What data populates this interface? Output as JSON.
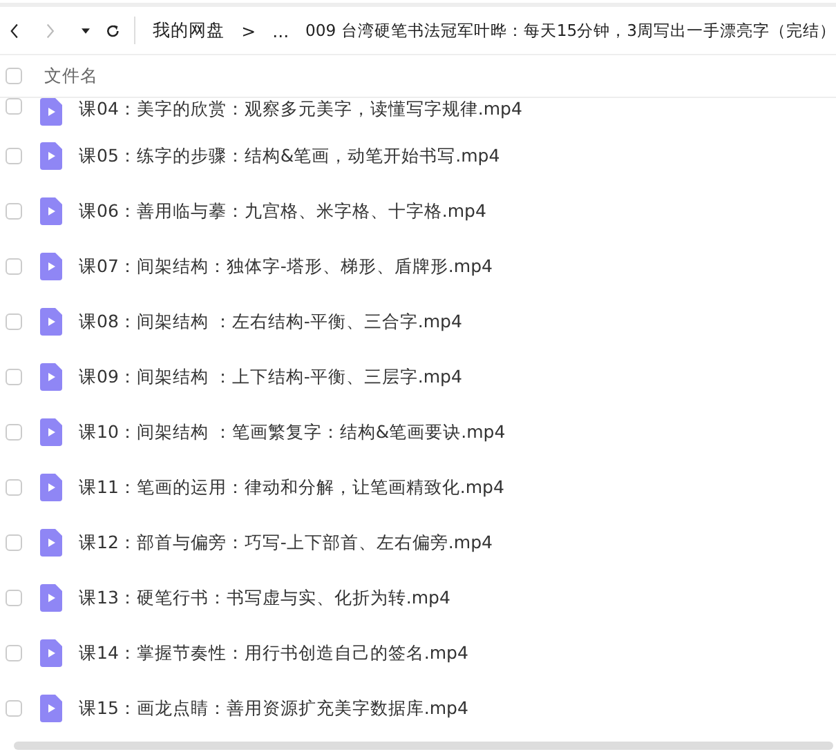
{
  "toolbar": {
    "back_disabled": false,
    "forward_disabled": true,
    "breadcrumb": [
      "我的网盘",
      ">",
      "...",
      "009 台湾硬笔书法冠军叶晔：每天15分钟，3周写出一手漂亮字（完结）"
    ]
  },
  "table": {
    "header": {
      "label": "文件名",
      "checked": false
    },
    "rows": [
      {
        "name": "课04：美字的欣赏：观察多元美字，读懂写字规律.mp4",
        "checked": false
      },
      {
        "name": "课05：练字的步骤：结构&笔画，动笔开始书写.mp4",
        "checked": false
      },
      {
        "name": "课06：善用临与摹：九宫格、米字格、十字格.mp4",
        "checked": false
      },
      {
        "name": "课07：间架结构：独体字-塔形、梯形、盾牌形.mp4",
        "checked": false
      },
      {
        "name": "课08：间架结构 ：左右结构-平衡、三合字.mp4",
        "checked": false
      },
      {
        "name": "课09：间架结构 ：上下结构-平衡、三层字.mp4",
        "checked": false
      },
      {
        "name": "课10：间架结构 ：笔画繁复字：结构&笔画要诀.mp4",
        "checked": false
      },
      {
        "name": "课11：笔画的运用：律动和分解，让笔画精致化.mp4",
        "checked": false
      },
      {
        "name": "课12：部首与偏旁：巧写-上下部首、左右偏旁.mp4",
        "checked": false
      },
      {
        "name": "课13：硬笔行书：书写虚与实、化折为转.mp4",
        "checked": false
      },
      {
        "name": "课14：掌握节奏性：用行书创造自己的签名.mp4",
        "checked": false
      },
      {
        "name": "课15：画龙点睛：善用资源扩充美字数据库.mp4",
        "checked": false
      }
    ]
  }
}
